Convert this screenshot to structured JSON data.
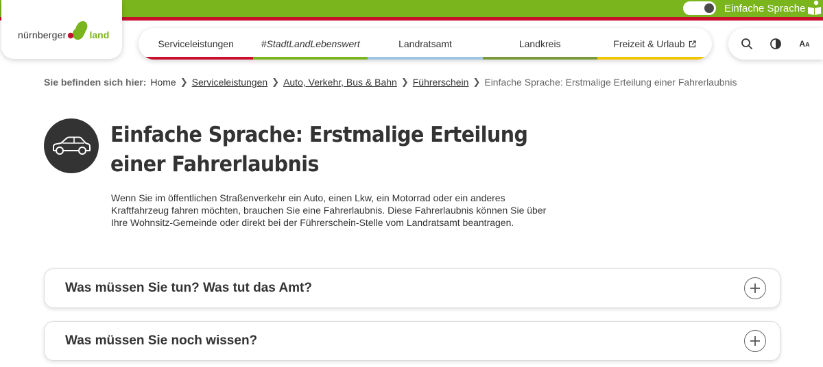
{
  "topbar": {
    "toggle_label": "Einfache Sprache",
    "colors": {
      "green": "#7ab51d",
      "red": "#c8102e"
    }
  },
  "logo": {
    "word1": "nürnberger",
    "word2": "land"
  },
  "nav": [
    {
      "label": "Serviceleistungen"
    },
    {
      "label": "#StadtLandLebenswert"
    },
    {
      "label": "Landratsamt"
    },
    {
      "label": "Landkreis"
    },
    {
      "label": "Freizeit & Urlaub",
      "icon": "external-link-icon"
    }
  ],
  "tools": {
    "font_size_label": "A",
    "font_size_small": "A"
  },
  "breadcrumb": {
    "label": "Sie befinden sich hier:",
    "items": [
      "Home",
      "Serviceleistungen",
      "Auto, Verkehr, Bus & Bahn",
      "Führerschein"
    ],
    "current": "Einfache Sprache: Erstmalige Erteilung einer Fahrerlaubnis"
  },
  "page": {
    "icon": "car-icon",
    "title_line1": "Einfache Sprache: Erstmalige Erteilung",
    "title_line2": "einer Fahrerlaubnis",
    "intro_line1": "Wenn Sie im öffentlichen Straßenverkehr ein Auto, einen Lkw, ein Motorrad oder ein anderes",
    "intro_line2": "Kraftfahrzeug fahren möchten, brauchen Sie eine Fahrerlaubnis. Diese Fahrerlaubnis können Sie über",
    "intro_line3": "Ihre Wohnsitz-Gemeinde oder direkt bei der Führerschein-Stelle vom Landratsamt beantragen."
  },
  "accordion": [
    {
      "title": "Was müssen Sie tun? Was tut das Amt?"
    },
    {
      "title": "Was müssen Sie noch wissen?"
    }
  ]
}
